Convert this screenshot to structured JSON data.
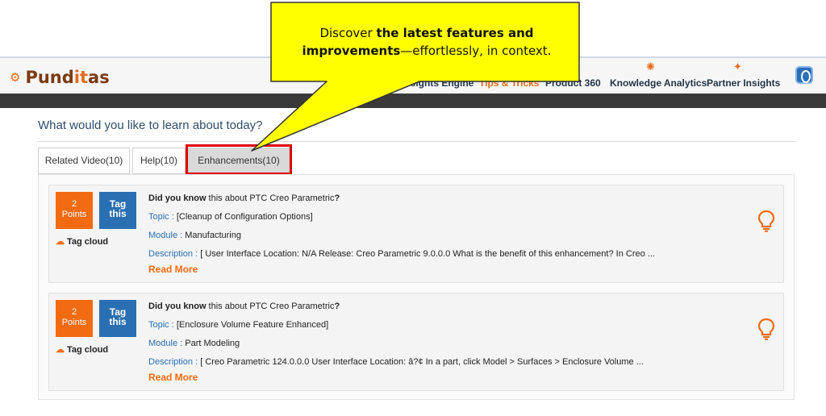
{
  "app": {
    "logo_prefix": "Pund",
    "logo_accent": "it",
    "logo_suffix": "as"
  },
  "nav": {
    "items": [
      {
        "label": "Insights Engine"
      },
      {
        "label": "Tips & Tricks"
      },
      {
        "label": "Product 360"
      },
      {
        "label": "Knowledge Analytics"
      },
      {
        "label": "Partner Insights"
      }
    ]
  },
  "callout": {
    "pre": "Discover ",
    "bold": "the latest features and improvements",
    "post": "—effortlessly, in context."
  },
  "page": {
    "title": "What would you like to learn about today?"
  },
  "tabs": [
    {
      "label": "Related Video(10)"
    },
    {
      "label": "Help(10)"
    },
    {
      "label": "Enhancements(10)"
    }
  ],
  "cards": [
    {
      "points_value": "2",
      "points_label": "Points",
      "tag_label_1": "Tag",
      "tag_label_2": "this",
      "tag_cloud": "Tag cloud",
      "dyk_bold": "Did you know",
      "dyk_text": " this about PTC Creo Parametric",
      "dyk_end": "?",
      "topic_key": "Topic : ",
      "topic": "[Cleanup of Configuration Options]",
      "module_key": "Module : ",
      "module": "Manufacturing",
      "description_key": "Description : ",
      "description": "[ User Interface Location: N/A Release: Creo Parametric 9.0.0.0 What is the benefit of this enhancement? In Creo ...",
      "read_more": "Read More"
    },
    {
      "points_value": "2",
      "points_label": "Points",
      "tag_label_1": "Tag",
      "tag_label_2": "this",
      "tag_cloud": "Tag cloud",
      "dyk_bold": "Did you know",
      "dyk_text": " this about PTC Creo Parametric",
      "dyk_end": "?",
      "topic_key": "Topic : ",
      "topic": "[Enclosure Volume Feature Enhanced]",
      "module_key": "Module : ",
      "module": "Part Modeling",
      "description_key": "Description : ",
      "description": "[ Creo Parametric 124.0.0.0 User Interface Location: â?¢ In a part, click Model > Surfaces > Enclosure Volume ...",
      "read_more": "Read More"
    }
  ],
  "colors": {
    "accent": "#f26b12",
    "brand_blue": "#2a6fb2",
    "callout_yellow": "#ffff00",
    "highlight_red": "#e00000"
  }
}
